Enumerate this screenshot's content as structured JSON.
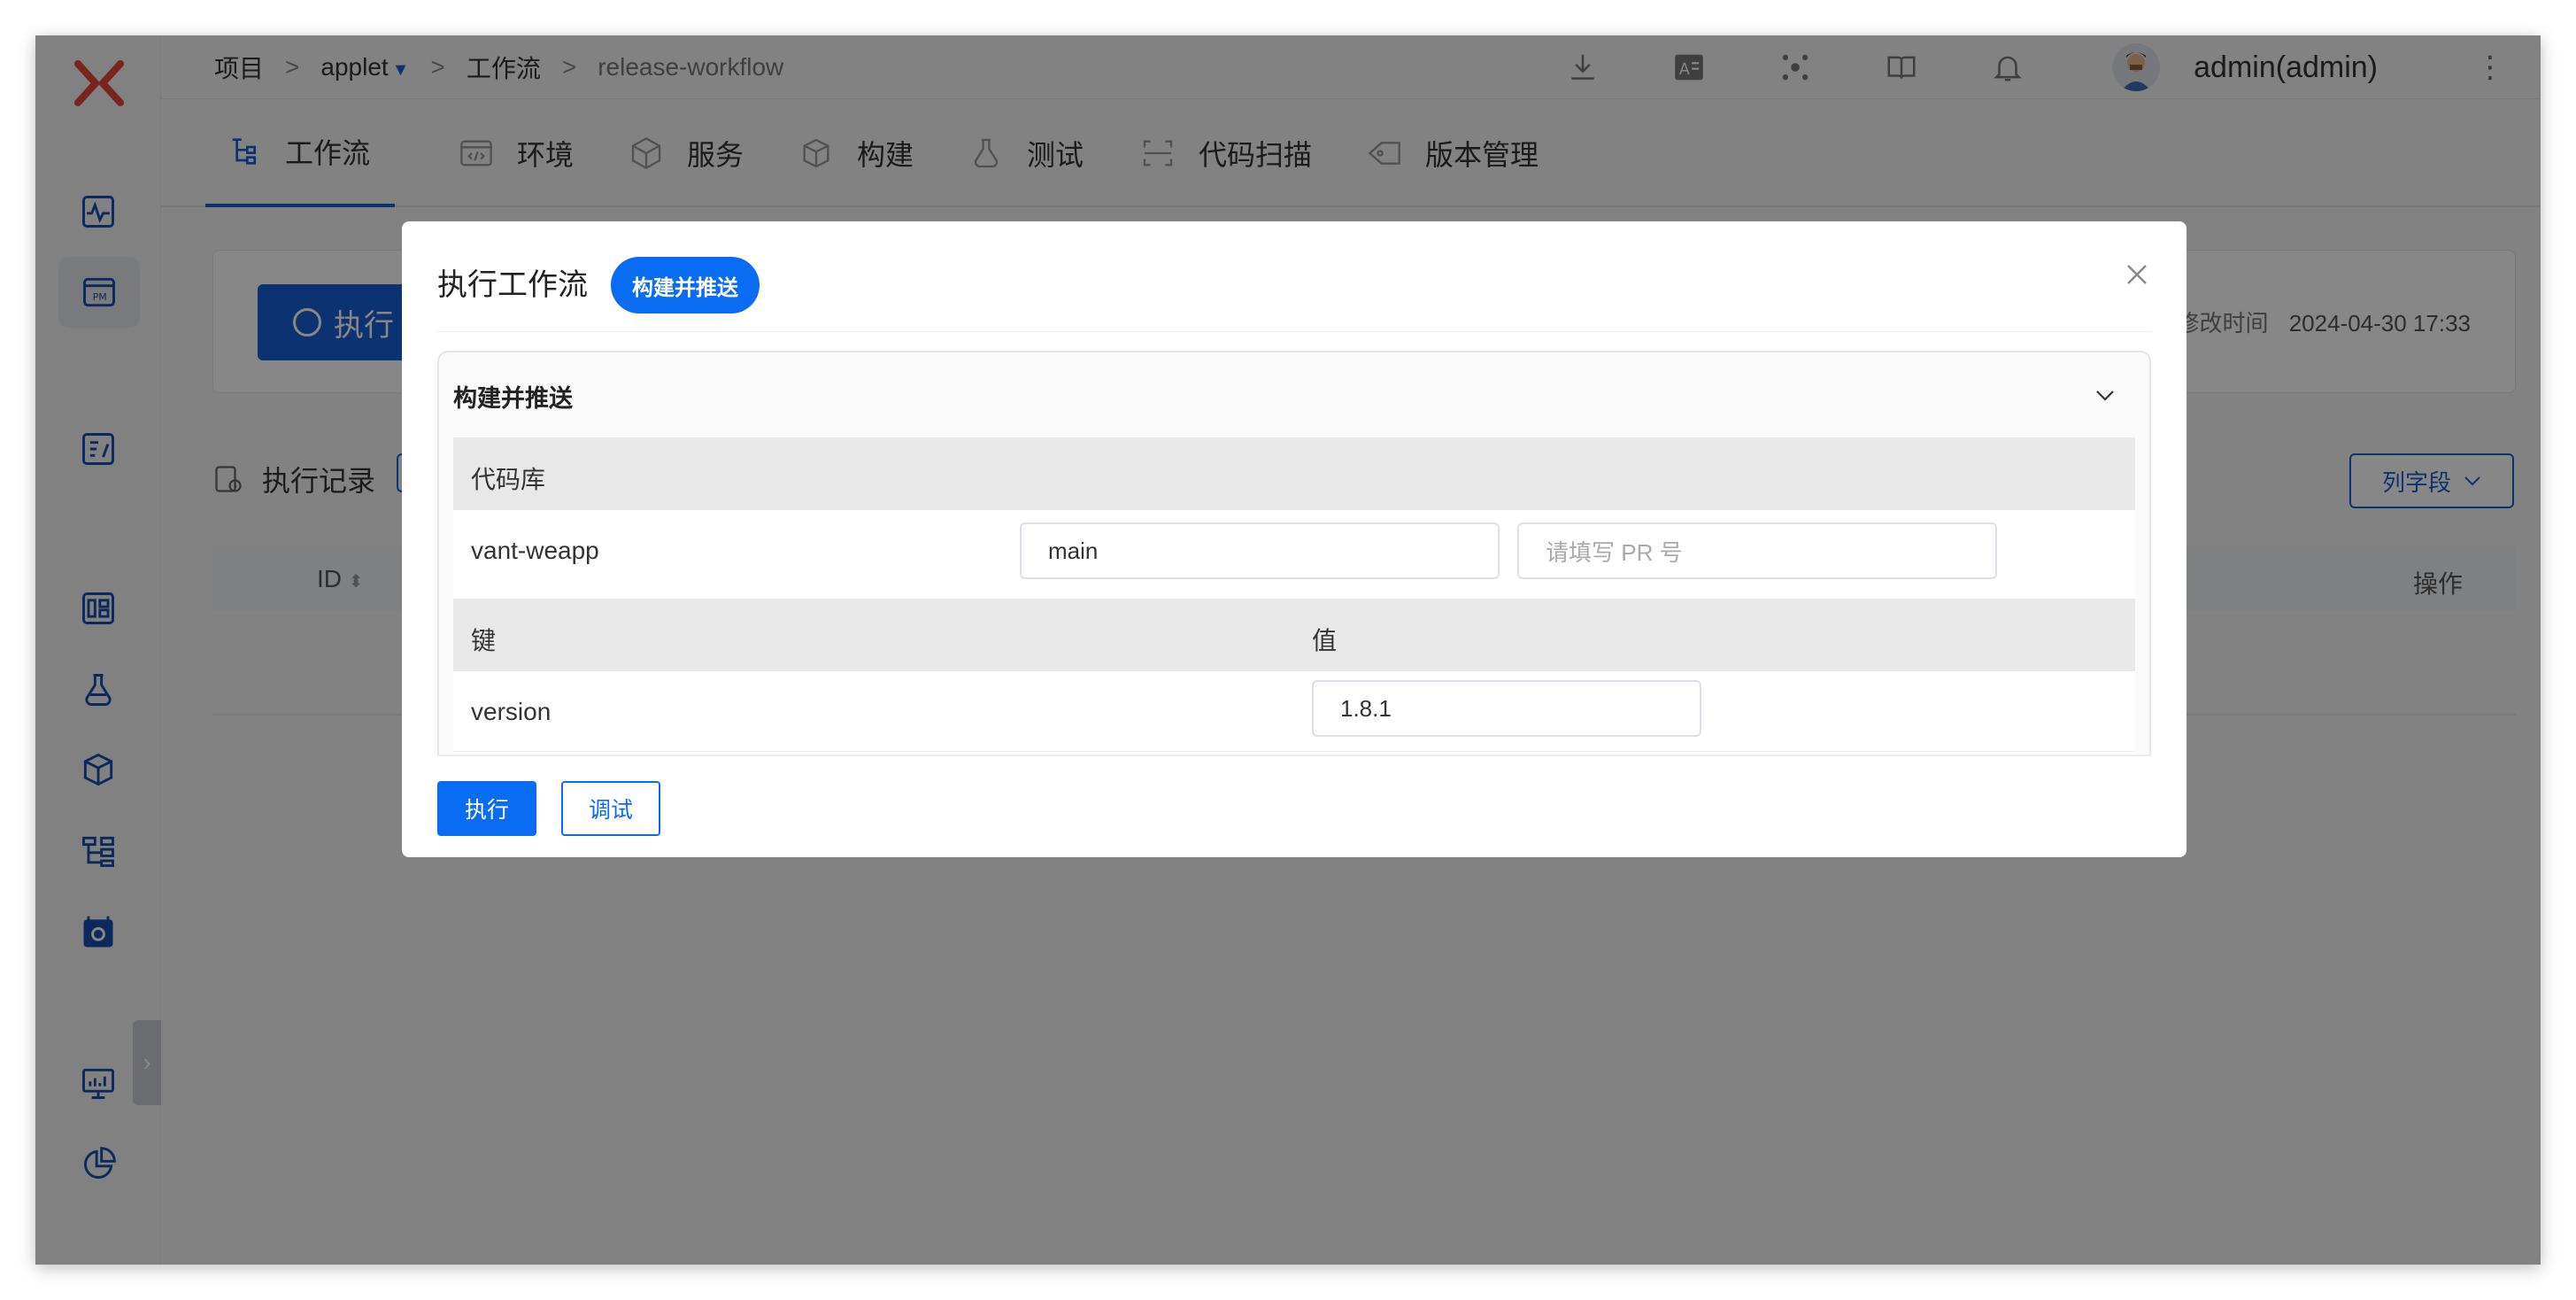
{
  "breadcrumb": {
    "project_label": "项目",
    "sep1": ">",
    "project_name": "applet",
    "sep2": ">",
    "section": "工作流",
    "sep3": ">",
    "workflow": "release-workflow"
  },
  "user": {
    "name": "admin(admin)"
  },
  "nav_tabs": [
    {
      "label": "工作流",
      "icon": "workflow-icon",
      "active": true
    },
    {
      "label": "环境",
      "icon": "code-icon"
    },
    {
      "label": "服务",
      "icon": "cube-icon"
    },
    {
      "label": "构建",
      "icon": "box-icon"
    },
    {
      "label": "测试",
      "icon": "flask-icon"
    },
    {
      "label": "代码扫描",
      "icon": "scan-icon"
    },
    {
      "label": "版本管理",
      "icon": "tag-icon"
    }
  ],
  "content": {
    "run_label": "执行",
    "modified_label": "修改时间",
    "modified_value": "2024-04-30 17:33",
    "records_title": "执行记录",
    "columns_button": "列字段",
    "table_id": "ID",
    "table_op": "操作"
  },
  "modal": {
    "title": "执行工作流",
    "badge": "构建并推送",
    "panel_title": "构建并推送",
    "repo_header": "代码库",
    "repo_name": "vant-weapp",
    "branch_value": "main",
    "pr_placeholder": "请填写 PR 号",
    "key_header": "键",
    "value_header": "值",
    "param_key": "version",
    "param_value": "1.8.1",
    "execute_button": "执行",
    "debug_button": "调试"
  },
  "colors": {
    "primary": "#0a6cf2",
    "accent": "#1a5fd6",
    "overlay": "rgba(0,0,0,0.47)"
  }
}
